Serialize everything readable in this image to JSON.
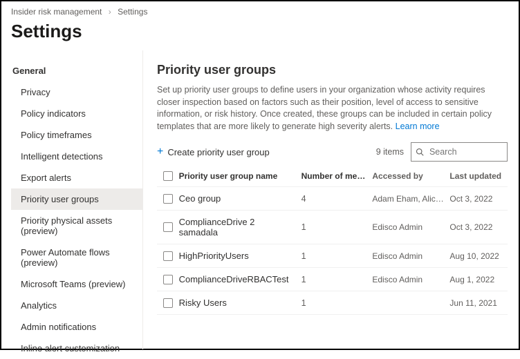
{
  "breadcrumb": {
    "root": "Insider risk management",
    "current": "Settings"
  },
  "page_title": "Settings",
  "sidebar": {
    "heading": "General",
    "items": [
      {
        "label": "Privacy",
        "active": false
      },
      {
        "label": "Policy indicators",
        "active": false
      },
      {
        "label": "Policy timeframes",
        "active": false
      },
      {
        "label": "Intelligent detections",
        "active": false
      },
      {
        "label": "Export alerts",
        "active": false
      },
      {
        "label": "Priority user groups",
        "active": true
      },
      {
        "label": "Priority physical assets (preview)",
        "active": false
      },
      {
        "label": "Power Automate flows (preview)",
        "active": false
      },
      {
        "label": "Microsoft Teams (preview)",
        "active": false
      },
      {
        "label": "Analytics",
        "active": false
      },
      {
        "label": "Admin notifications",
        "active": false
      },
      {
        "label": "Inline alert customization",
        "active": false
      }
    ]
  },
  "main": {
    "title": "Priority user groups",
    "description": "Set up priority user groups to define users in your organization whose activity requires closer inspection based on factors such as their position, level of access to sensitive information, or risk history. Once created, these groups can be included in certain policy templates that are more likely to generate high severity alerts.",
    "learn_more": "Learn more",
    "create_label": "Create priority user group",
    "item_count": "9 items",
    "search_placeholder": "Search",
    "columns": {
      "name": "Priority user group name",
      "members": "Number of memb…",
      "access": "Accessed by",
      "updated": "Last updated"
    },
    "rows": [
      {
        "name": "Ceo group",
        "members": "4",
        "access": "Adam Eham, Alice Doe",
        "updated": "Oct 3, 2022"
      },
      {
        "name": "ComplianceDrive 2 samadala",
        "members": "1",
        "access": "Edisco Admin",
        "updated": "Oct 3, 2022"
      },
      {
        "name": "HighPriorityUsers",
        "members": "1",
        "access": "Edisco Admin",
        "updated": "Aug 10, 2022"
      },
      {
        "name": "ComplianceDriveRBACTest",
        "members": "1",
        "access": "Edisco Admin",
        "updated": "Aug 1, 2022"
      },
      {
        "name": "Risky Users",
        "members": "1",
        "access": "",
        "updated": "Jun 11, 2021"
      }
    ]
  }
}
